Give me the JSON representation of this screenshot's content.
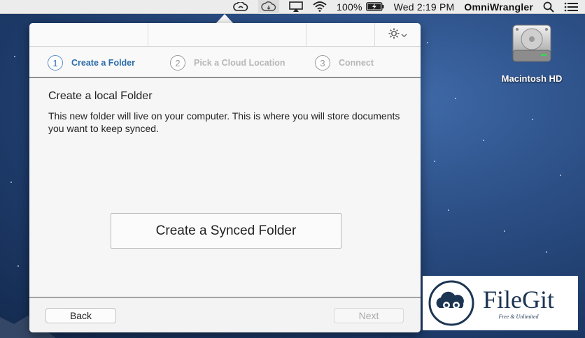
{
  "menubar": {
    "battery": "100%",
    "clock": "Wed 2:19 PM",
    "user": "OmniWrangler",
    "icons": [
      "creative-cloud-icon",
      "cloud-sync-icon",
      "airplay-icon",
      "wifi-icon",
      "battery-icon",
      "spotlight-search-icon",
      "notification-center-icon"
    ]
  },
  "desktop": {
    "drive_label": "Macintosh HD"
  },
  "wizard": {
    "steps": [
      {
        "num": "1",
        "label": "Create a Folder",
        "active": true
      },
      {
        "num": "2",
        "label": "Pick a Cloud Location",
        "active": false
      },
      {
        "num": "3",
        "label": "Connect",
        "active": false
      }
    ],
    "heading": "Create a local Folder",
    "description": "This new folder will live on your computer. This is where you will store documents you want to keep synced.",
    "primary_button": "Create a Synced Folder",
    "back_label": "Back",
    "next_label": "Next"
  },
  "watermark": {
    "title": "FileGit",
    "subtitle": "Free & Unlimited"
  },
  "colors": {
    "active_step": "#2c6ca8",
    "inactive_step": "#b7b7b7",
    "desktop_bg": "#2c4f86"
  }
}
